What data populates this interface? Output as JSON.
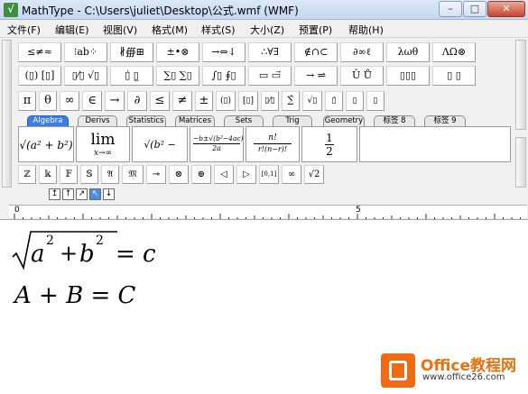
{
  "window": {
    "title": "MathType - C:\\Users\\juliet\\Desktop\\公式.wmf (WMF)",
    "minimize": "–",
    "maximize": "□",
    "close": "✕"
  },
  "menu": [
    "文件(F)",
    "编辑(E)",
    "视图(V)",
    "格式(M)",
    "样式(S)",
    "大小(Z)",
    "预置(P)",
    "帮助(H)"
  ],
  "symbol_row1": [
    "≤≠≈",
    "⁝ab⁘",
    "∦∰⊞",
    "±•⊗",
    "→⇔↓",
    "∴∀∃",
    "∉∩⊂",
    "∂∞ℓ",
    "λωθ",
    "ΛΩ⊗"
  ],
  "symbol_row2": [
    "(▯) [▯]",
    "▯⁄▯ √▯",
    "▯̇ ▯̲",
    "∑▯ ∑▯",
    "∫▯ ∮▯",
    "▭ ▭⃗",
    "→ ⇌",
    "Ū Ů",
    "▯▯▯",
    "▯ ▯"
  ],
  "small_row": [
    "π",
    "θ",
    "∞",
    "∈",
    "→",
    "∂",
    "≤",
    "≠",
    "±",
    "(▯)",
    "[▯]",
    "▯⁄▯",
    "∑̂",
    "√▯",
    "▯̇",
    "▯",
    "▯"
  ],
  "tabs": [
    "Algebra",
    "Derivs",
    "Statistics",
    "Matrices",
    "Sets",
    "Trig",
    "Geometry",
    "标签 8",
    "标签 9"
  ],
  "templates": {
    "t1": "√(a² + b²)",
    "t2_lim": "lim",
    "t2_sub": "x→∞",
    "t3": "√(b² − 4ac)",
    "t4_num": "−b±√(b²−4ac)",
    "t4_den": "2a",
    "t5_num": "n!",
    "t5_den": "r!(n−r)!",
    "t6_num": "1",
    "t6_den": "2"
  },
  "font_row": [
    "ℤ",
    "𝕜",
    "𝔽",
    "𝕊",
    "𝔄",
    "𝔐",
    "⊸",
    "⊗",
    "⊕",
    "◁",
    "▷",
    "[0,1]",
    "∞",
    "√2"
  ],
  "nudge": [
    "↥",
    "↑",
    "↗",
    "↖",
    "↓"
  ],
  "ruler": {
    "zero": "0",
    "five": "5"
  },
  "editor": {
    "eq1_lhs": "√(a² + b²)",
    "eq1_a": "a",
    "eq1_plus": "+",
    "eq1_b": "b",
    "eq1_exp": "2",
    "eq1_rhs": "= c",
    "eq2": "A + B = C"
  },
  "watermark": {
    "brand": "Office教程网",
    "url": "www.office26.com"
  },
  "colors": {
    "tab_active": "#3c7de3",
    "logo_orange": "#ef6c12"
  }
}
